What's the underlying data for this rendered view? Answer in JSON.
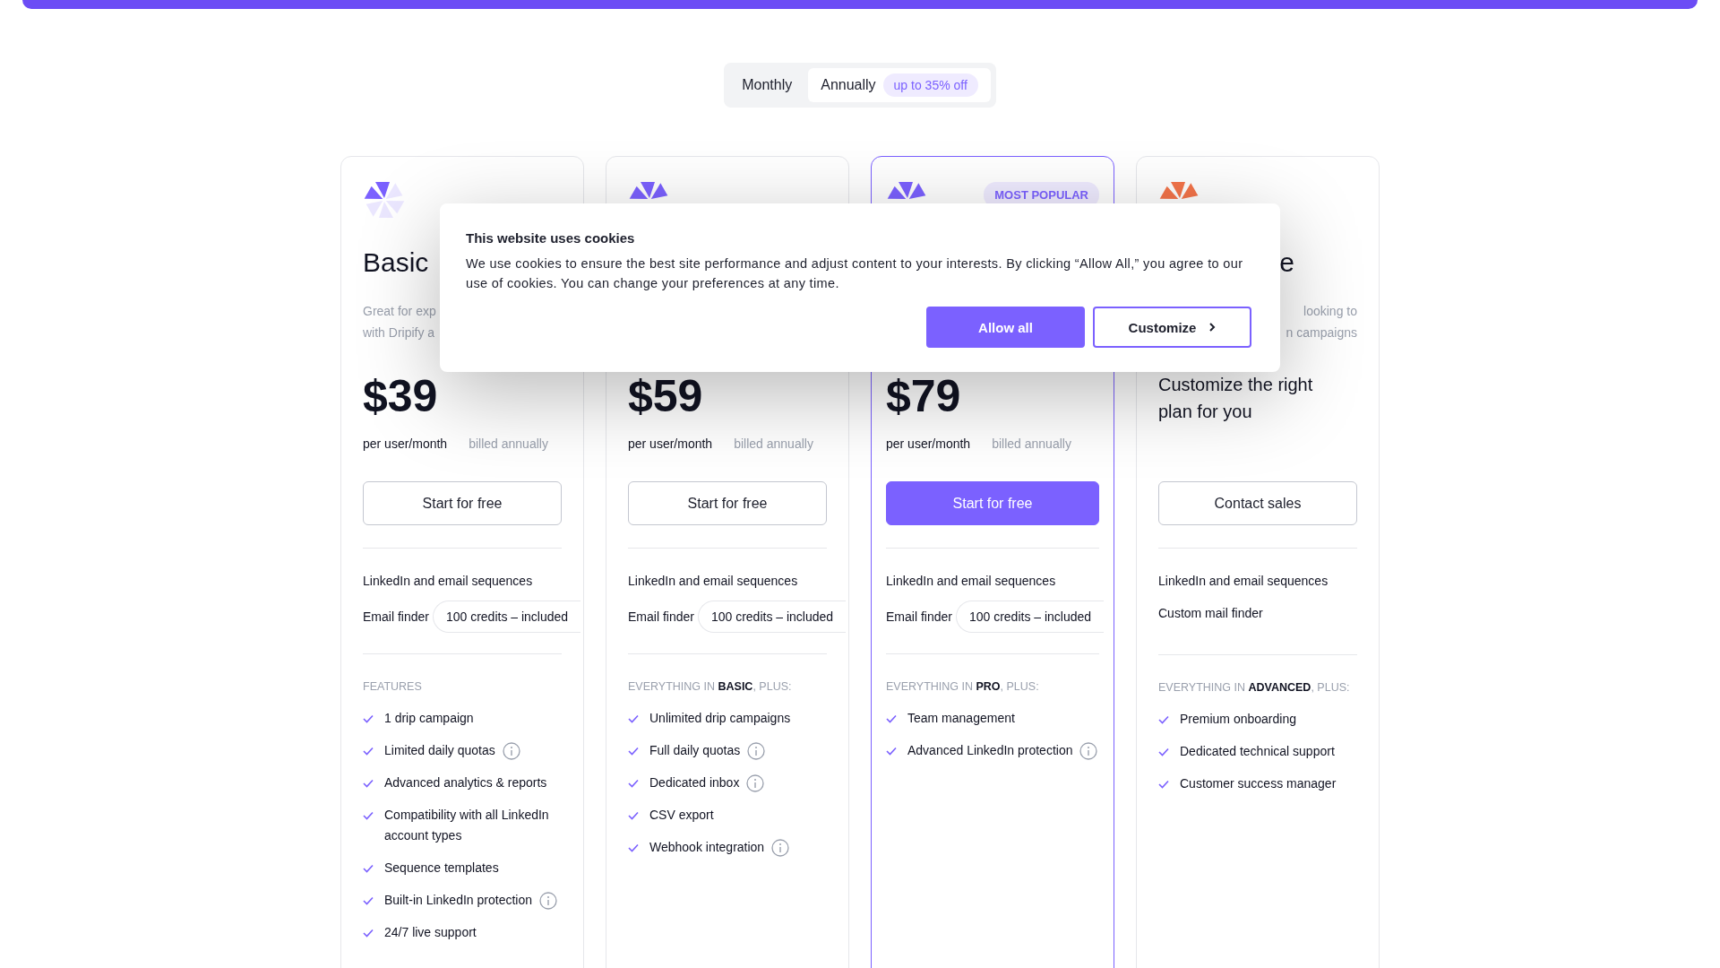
{
  "billing_toggle": {
    "options": [
      {
        "label": "Monthly",
        "selected": false
      },
      {
        "label": "Annually",
        "selected": true,
        "badge": "up to 35% off"
      }
    ]
  },
  "plans": [
    {
      "kind": "standard",
      "color": "#7b61ff",
      "highlighted": false,
      "title": "Basic",
      "description": [
        "Great for exp",
        "with Dripify a"
      ],
      "price": "$39",
      "period": "per user/month",
      "billing": "billed annually",
      "button": "Start for free",
      "included": [
        {
          "text": "LinkedIn and email sequences"
        },
        {
          "text": "Email finder",
          "pill": "100 credits – included"
        }
      ],
      "features_heading": "FEATURES",
      "features": [
        {
          "text": "1 drip campaign",
          "info": false
        },
        {
          "text": "Limited daily quotas",
          "info": true
        },
        {
          "text": "Advanced analytics & reports",
          "info": false
        },
        {
          "text": "Compatibility with all LinkedIn account types",
          "info": false
        },
        {
          "text": "Sequence templates",
          "info": false
        },
        {
          "text": "Built-in LinkedIn protection",
          "info": true
        },
        {
          "text": "24/7 live support",
          "info": false
        }
      ]
    },
    {
      "kind": "standard",
      "color": "#7b61ff",
      "highlighted": false,
      "price": "$59",
      "period": "per user/month",
      "billing": "billed annually",
      "button": "Start for free",
      "included": [
        {
          "text": "LinkedIn and email sequences"
        },
        {
          "text": "Email finder",
          "pill": "100 credits – included"
        }
      ],
      "features_heading": "EVERYTHING IN **BASIC**, PLUS:",
      "features": [
        {
          "text": "Unlimited drip campaigns",
          "info": false
        },
        {
          "text": "Full daily quotas",
          "info": true
        },
        {
          "text": "Dedicated inbox",
          "info": true
        },
        {
          "text": "CSV export",
          "info": false
        },
        {
          "text": "Webhook integration",
          "info": true
        }
      ]
    },
    {
      "kind": "standard",
      "color": "#7b61ff",
      "highlighted": true,
      "badge": "MOST POPULAR",
      "price": "$79",
      "period": "per user/month",
      "billing": "billed annually",
      "button": "Start for free",
      "included": [
        {
          "text": "LinkedIn and email sequences"
        },
        {
          "text": "Email finder",
          "pill": "100 credits – included"
        }
      ],
      "features_heading": "EVERYTHING IN **PRO**, PLUS:",
      "features": [
        {
          "text": "Team management",
          "info": false
        },
        {
          "text": "Advanced LinkedIn protection",
          "info": true
        }
      ]
    },
    {
      "kind": "custom",
      "color": "#f4744a",
      "highlighted": false,
      "title": "e",
      "description": [
        "looking to",
        "n campaigns"
      ],
      "tagline": "Customize the right plan for you",
      "button": "Contact sales",
      "included": [
        {
          "text": "LinkedIn and email sequences"
        },
        {
          "text": "Custom mail finder"
        }
      ],
      "features_heading": "EVERYTHING IN **ADVANCED**, PLUS:",
      "features": [
        {
          "text": "Premium onboarding",
          "info": false
        },
        {
          "text": "Dedicated technical support",
          "info": false
        },
        {
          "text": "Customer success manager",
          "info": false
        }
      ]
    }
  ],
  "cookie_dialog": {
    "title": "This website uses cookies",
    "body": "We use cookies to ensure the best site performance and adjust content to your interests. By clicking “Allow All,” you agree to our use of cookies. You can change your preferences at any time.",
    "buttons": [
      {
        "label": "Allow all",
        "kind": "primary"
      },
      {
        "label": "Customize",
        "kind": "secondary"
      }
    ]
  }
}
